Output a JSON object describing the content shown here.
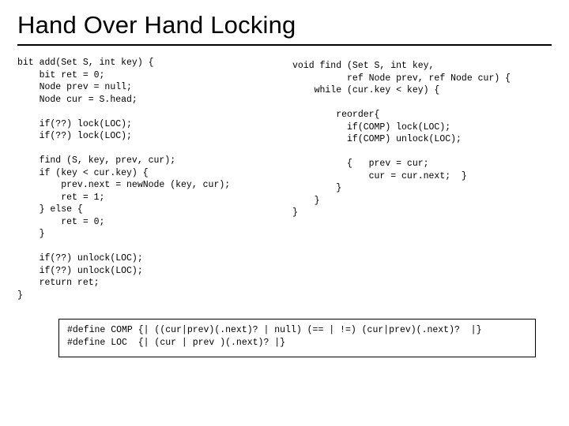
{
  "title": "Hand Over Hand Locking",
  "left_code": "bit add(Set S, int key) {\n    bit ret = 0;\n    Node prev = null;\n    Node cur = S.head;\n\n    if(??) lock(LOC);\n    if(??) lock(LOC);\n\n    find (S, key, prev, cur);\n    if (key < cur.key) {\n        prev.next = newNode (key, cur);\n        ret = 1;\n    } else {\n        ret = 0;\n    }\n\n    if(??) unlock(LOC);\n    if(??) unlock(LOC);\n    return ret;\n}",
  "right_code": "void find (Set S, int key,\n          ref Node prev, ref Node cur) {\n    while (cur.key < key) {\n\n        reorder{\n          if(COMP) lock(LOC);\n          if(COMP) unlock(LOC);\n\n          {   prev = cur;\n              cur = cur.next;  }\n        }\n    }\n}",
  "defines": "#define COMP {| ((cur|prev)(.next)? | null) (== | !=) (cur|prev)(.next)?  |}\n#define LOC  {| (cur | prev )(.next)? |}"
}
